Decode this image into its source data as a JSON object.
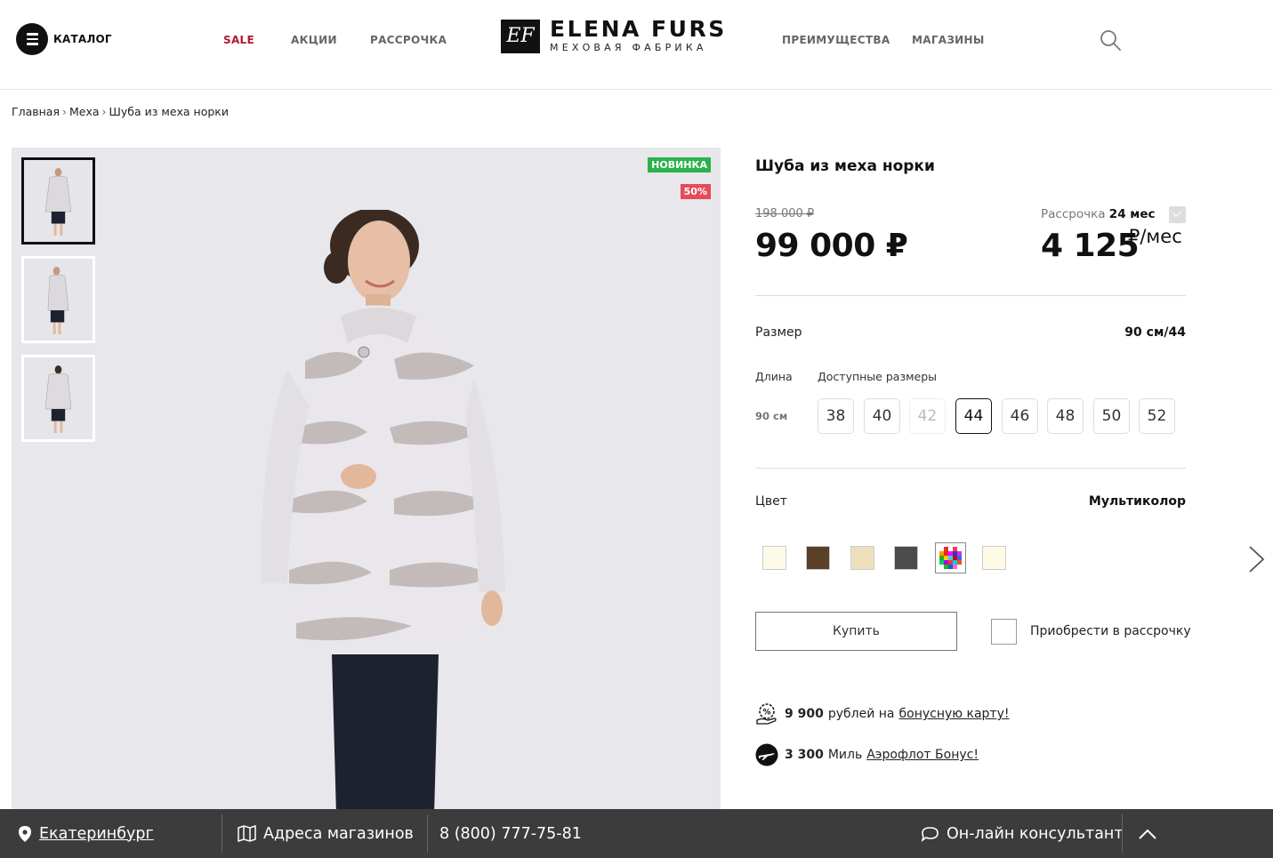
{
  "header": {
    "catalog_label": "КАТАЛОГ",
    "nav_left": [
      "SALE",
      "АКЦИИ",
      "РАССРОЧКА"
    ],
    "nav_right": [
      "ПРЕИМУЩЕСТВА",
      "МАГАЗИНЫ"
    ],
    "logo_mark": "EF",
    "logo_title": "ELENA FURS",
    "logo_subtitle": "МЕХОВАЯ ФАБРИКА",
    "search_icon": "search-icon",
    "sale_color": "#b3182c"
  },
  "breadcrumb": {
    "items": [
      "Главная",
      "Меха",
      "Шуба из меха норки"
    ],
    "separator": "›"
  },
  "gallery": {
    "badge_new": "НОВИНКА",
    "badge_sale": "50%",
    "badge_new_color": "#2bb24c",
    "badge_sale_color": "#e44c5a",
    "thumb_count": 3,
    "active_thumb": 0
  },
  "product": {
    "title": "Шуба из меха норки",
    "old_price": "198 000 ₽",
    "price": "99 000 ₽",
    "installment_label": "Рассрочка",
    "installment_term": "24 мес",
    "installment_price": "4 125",
    "installment_unit": "₽/мес",
    "size_label": "Размер",
    "size_value": "90 см/44",
    "length_label": "Длина",
    "available_sizes_label": "Доступные размеры",
    "length_value": "90 см",
    "sizes": [
      {
        "label": "38",
        "state": "normal"
      },
      {
        "label": "40",
        "state": "normal"
      },
      {
        "label": "42",
        "state": "disabled"
      },
      {
        "label": "44",
        "state": "selected"
      },
      {
        "label": "46",
        "state": "normal"
      },
      {
        "label": "48",
        "state": "normal"
      },
      {
        "label": "50",
        "state": "normal"
      },
      {
        "label": "52",
        "state": "normal"
      }
    ],
    "color_label": "Цвет",
    "color_value": "Мультиколор",
    "swatches": [
      "#fdfbe8",
      "#5a4029",
      "#efe0bd",
      "#4a4b4d",
      "multicolor",
      "#fdfbe3"
    ],
    "active_swatch": 4,
    "buy_label": "Купить",
    "installment_checkbox_label": "Приобрести в рассрочку",
    "bonus_amount": "9 900",
    "bonus_text": "рублей на",
    "bonus_link": "бонусную карту!",
    "miles_amount": "3 300",
    "miles_text": "Миль",
    "miles_link": "Аэрофлот Бонус!"
  },
  "footer": {
    "city": "Екатеринбург",
    "stores": "Адреса магазинов",
    "phone": "8 (800) 777-75-81",
    "consultant": "Он-лайн консультант",
    "bg_color": "#3c3c3c"
  }
}
